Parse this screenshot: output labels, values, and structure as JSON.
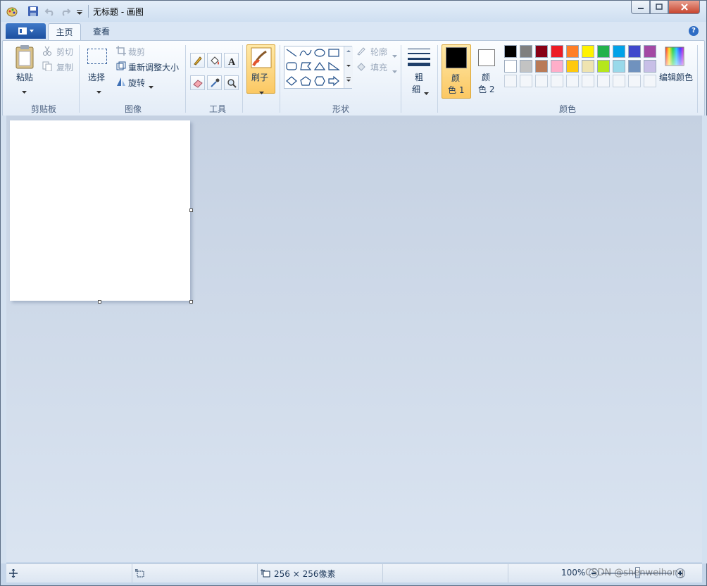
{
  "title": "无标题 - 画图",
  "tabs": {
    "home": "主页",
    "view": "查看"
  },
  "clipboard": {
    "paste": "粘贴",
    "cut": "剪切",
    "copy": "复制",
    "label": "剪贴板"
  },
  "image": {
    "select": "选择",
    "crop": "裁剪",
    "resize": "重新调整大小",
    "rotate": "旋转",
    "label": "图像"
  },
  "tools": {
    "label": "工具"
  },
  "brush": {
    "label": "刷子"
  },
  "shapes": {
    "outline": "轮廓",
    "fill": "填充",
    "label": "形状"
  },
  "size": {
    "line1": "粗",
    "line2": "细"
  },
  "colors": {
    "color1_line1": "颜",
    "color1_line2": "色 1",
    "color2_line1": "颜",
    "color2_line2": "色 2",
    "edit": "编辑颜色",
    "label": "颜色",
    "color1": "#000000",
    "color2": "#ffffff",
    "palette_row1": [
      "#000000",
      "#7f7f7f",
      "#880015",
      "#ed1c24",
      "#ff7f27",
      "#fff200",
      "#22b14c",
      "#00a2e8",
      "#3f48cc",
      "#a349a4"
    ],
    "palette_row2": [
      "#ffffff",
      "#c3c3c3",
      "#b97a57",
      "#ffaec9",
      "#ffc90e",
      "#efe4b0",
      "#b5e61d",
      "#99d9ea",
      "#7092be",
      "#c8bfe7"
    ]
  },
  "status": {
    "dimensions": "256 × 256像素",
    "zoom": "100%"
  },
  "watermark": "CSDN @shenweihong"
}
